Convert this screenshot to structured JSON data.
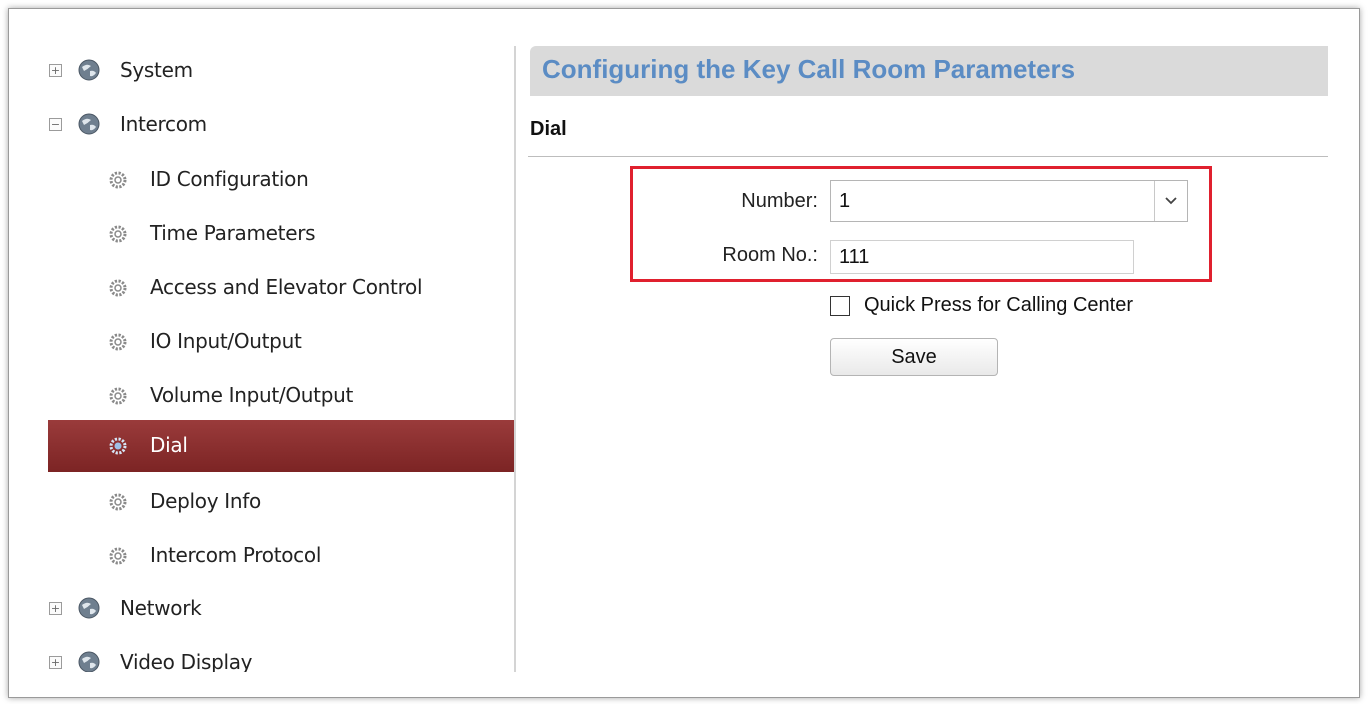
{
  "sidebar": {
    "system": {
      "label": "System",
      "expander": "+",
      "icon": "globe-icon"
    },
    "intercom": {
      "label": "Intercom",
      "expander": "−",
      "icon": "globe-icon"
    },
    "intercom_children": [
      {
        "label": "ID Configuration",
        "icon": "gear-icon"
      },
      {
        "label": "Time Parameters",
        "icon": "gear-icon"
      },
      {
        "label": "Access and Elevator Control",
        "icon": "gear-icon"
      },
      {
        "label": "IO Input/Output",
        "icon": "gear-icon"
      },
      {
        "label": "Volume Input/Output",
        "icon": "gear-icon"
      },
      {
        "label": "Dial",
        "icon": "gear-icon",
        "active": true
      },
      {
        "label": "Deploy Info",
        "icon": "gear-icon"
      },
      {
        "label": "Intercom Protocol",
        "icon": "gear-icon"
      }
    ],
    "network": {
      "label": "Network",
      "expander": "+",
      "icon": "globe-icon"
    },
    "video_display": {
      "label": "Video Display",
      "expander": "+",
      "icon": "globe-icon"
    }
  },
  "main": {
    "title": "Configuring the Key Call Room Parameters",
    "section": "Dial",
    "form": {
      "number_label": "Number:",
      "number_value": "1",
      "room_label": "Room No.:",
      "room_value": "111",
      "checkbox_label": "Quick Press for Calling Center",
      "checkbox_checked": false,
      "save_label": "Save"
    }
  },
  "colors": {
    "title_text": "#5b8cc4",
    "active_item_bg": "#8b2f2f",
    "highlight_box": "#e0202e"
  }
}
